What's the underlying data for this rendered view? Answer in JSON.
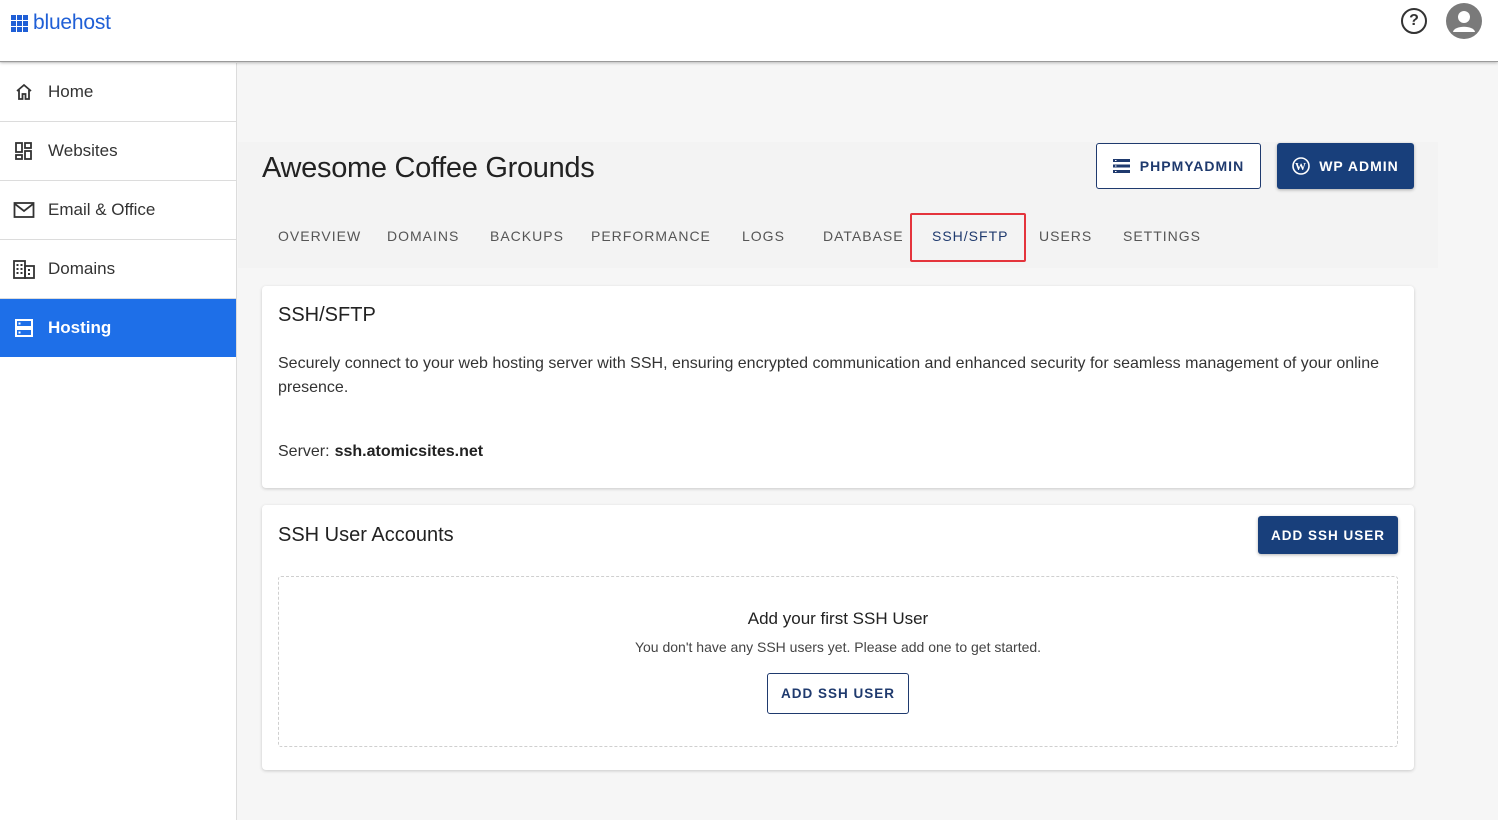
{
  "brand": {
    "name": "bluehost",
    "color": "#1f5fd6"
  },
  "topbar": {
    "help_icon": "help-circle-icon",
    "avatar_icon": "user-avatar-icon"
  },
  "sidebar": {
    "items": [
      {
        "label": "Home",
        "icon": "home-icon",
        "active": false
      },
      {
        "label": "Websites",
        "icon": "dashboard-grid-icon",
        "active": false
      },
      {
        "label": "Email & Office",
        "icon": "mail-icon",
        "active": false
      },
      {
        "label": "Domains",
        "icon": "building-icon",
        "active": false
      },
      {
        "label": "Hosting",
        "icon": "server-icon",
        "active": true
      }
    ],
    "active_color": "#1e6fe8"
  },
  "header": {
    "title": "Awesome Coffee Grounds",
    "phpmyadmin_label": "PHPMYADMIN",
    "wp_admin_label": "WP ADMIN",
    "tabs": [
      {
        "label": "OVERVIEW"
      },
      {
        "label": "DOMAINS"
      },
      {
        "label": "BACKUPS"
      },
      {
        "label": "PERFORMANCE"
      },
      {
        "label": "LOGS"
      },
      {
        "label": "DATABASE"
      },
      {
        "label": "SSH/SFTP",
        "active": true
      },
      {
        "label": "USERS"
      },
      {
        "label": "SETTINGS"
      }
    ]
  },
  "ssh_card": {
    "title": "SSH/SFTP",
    "description": "Securely connect to your web hosting server with SSH, ensuring encrypted communication and enhanced security for seamless management of your online presence.",
    "server_label": "Server:",
    "server_value": "ssh.atomicsites.net"
  },
  "users_card": {
    "title": "SSH User Accounts",
    "add_button_label": "ADD SSH USER",
    "empty_title": "Add your first SSH User",
    "empty_subtitle": "You don't have any SSH users yet. Please add one to get started.",
    "empty_button_label": "ADD SSH USER"
  },
  "colors": {
    "primary_dark": "#183f7b",
    "highlight_border": "#e4343c"
  }
}
